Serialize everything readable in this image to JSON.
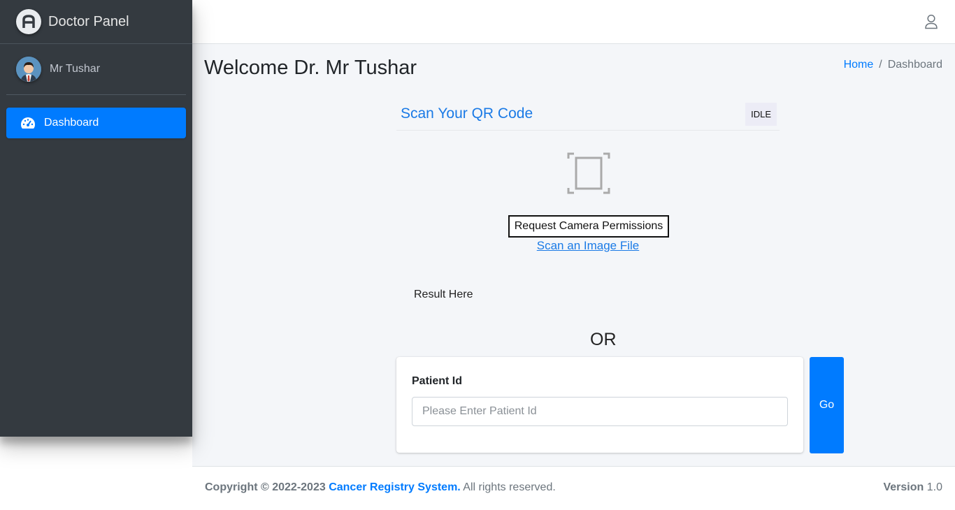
{
  "brand": {
    "title": "Doctor Panel",
    "logo_icon": "brand-logo-icon"
  },
  "user": {
    "name": "Mr Tushar",
    "avatar_icon": "doctor-avatar"
  },
  "sidebar": {
    "items": [
      {
        "label": "Dashboard",
        "icon": "dashboard-gauge-icon",
        "active": true
      }
    ]
  },
  "header": {
    "user_icon": "user-icon"
  },
  "page": {
    "title": "Welcome Dr. Mr Tushar",
    "breadcrumb": {
      "home": "Home",
      "separator": "/",
      "current": "Dashboard"
    }
  },
  "scanner": {
    "title": "Scan Your QR Code",
    "status": "IDLE",
    "permission_button": "Request Camera Permissions",
    "scan_file_link": "Scan an Image File",
    "result": "Result Here"
  },
  "or_text": "OR",
  "patient_form": {
    "label": "Patient Id",
    "placeholder": "Please Enter Patient Id",
    "value": "",
    "go_button": "Go"
  },
  "footer": {
    "copyright_prefix": "Copyright © 2022-2023",
    "org": "Cancer Registry System.",
    "rights": "All rights reserved.",
    "version_label": "Version",
    "version_value": "1.0"
  },
  "colors": {
    "primary": "#007bff",
    "sidebar": "#343a40",
    "content_bg": "#f4f6f9"
  }
}
